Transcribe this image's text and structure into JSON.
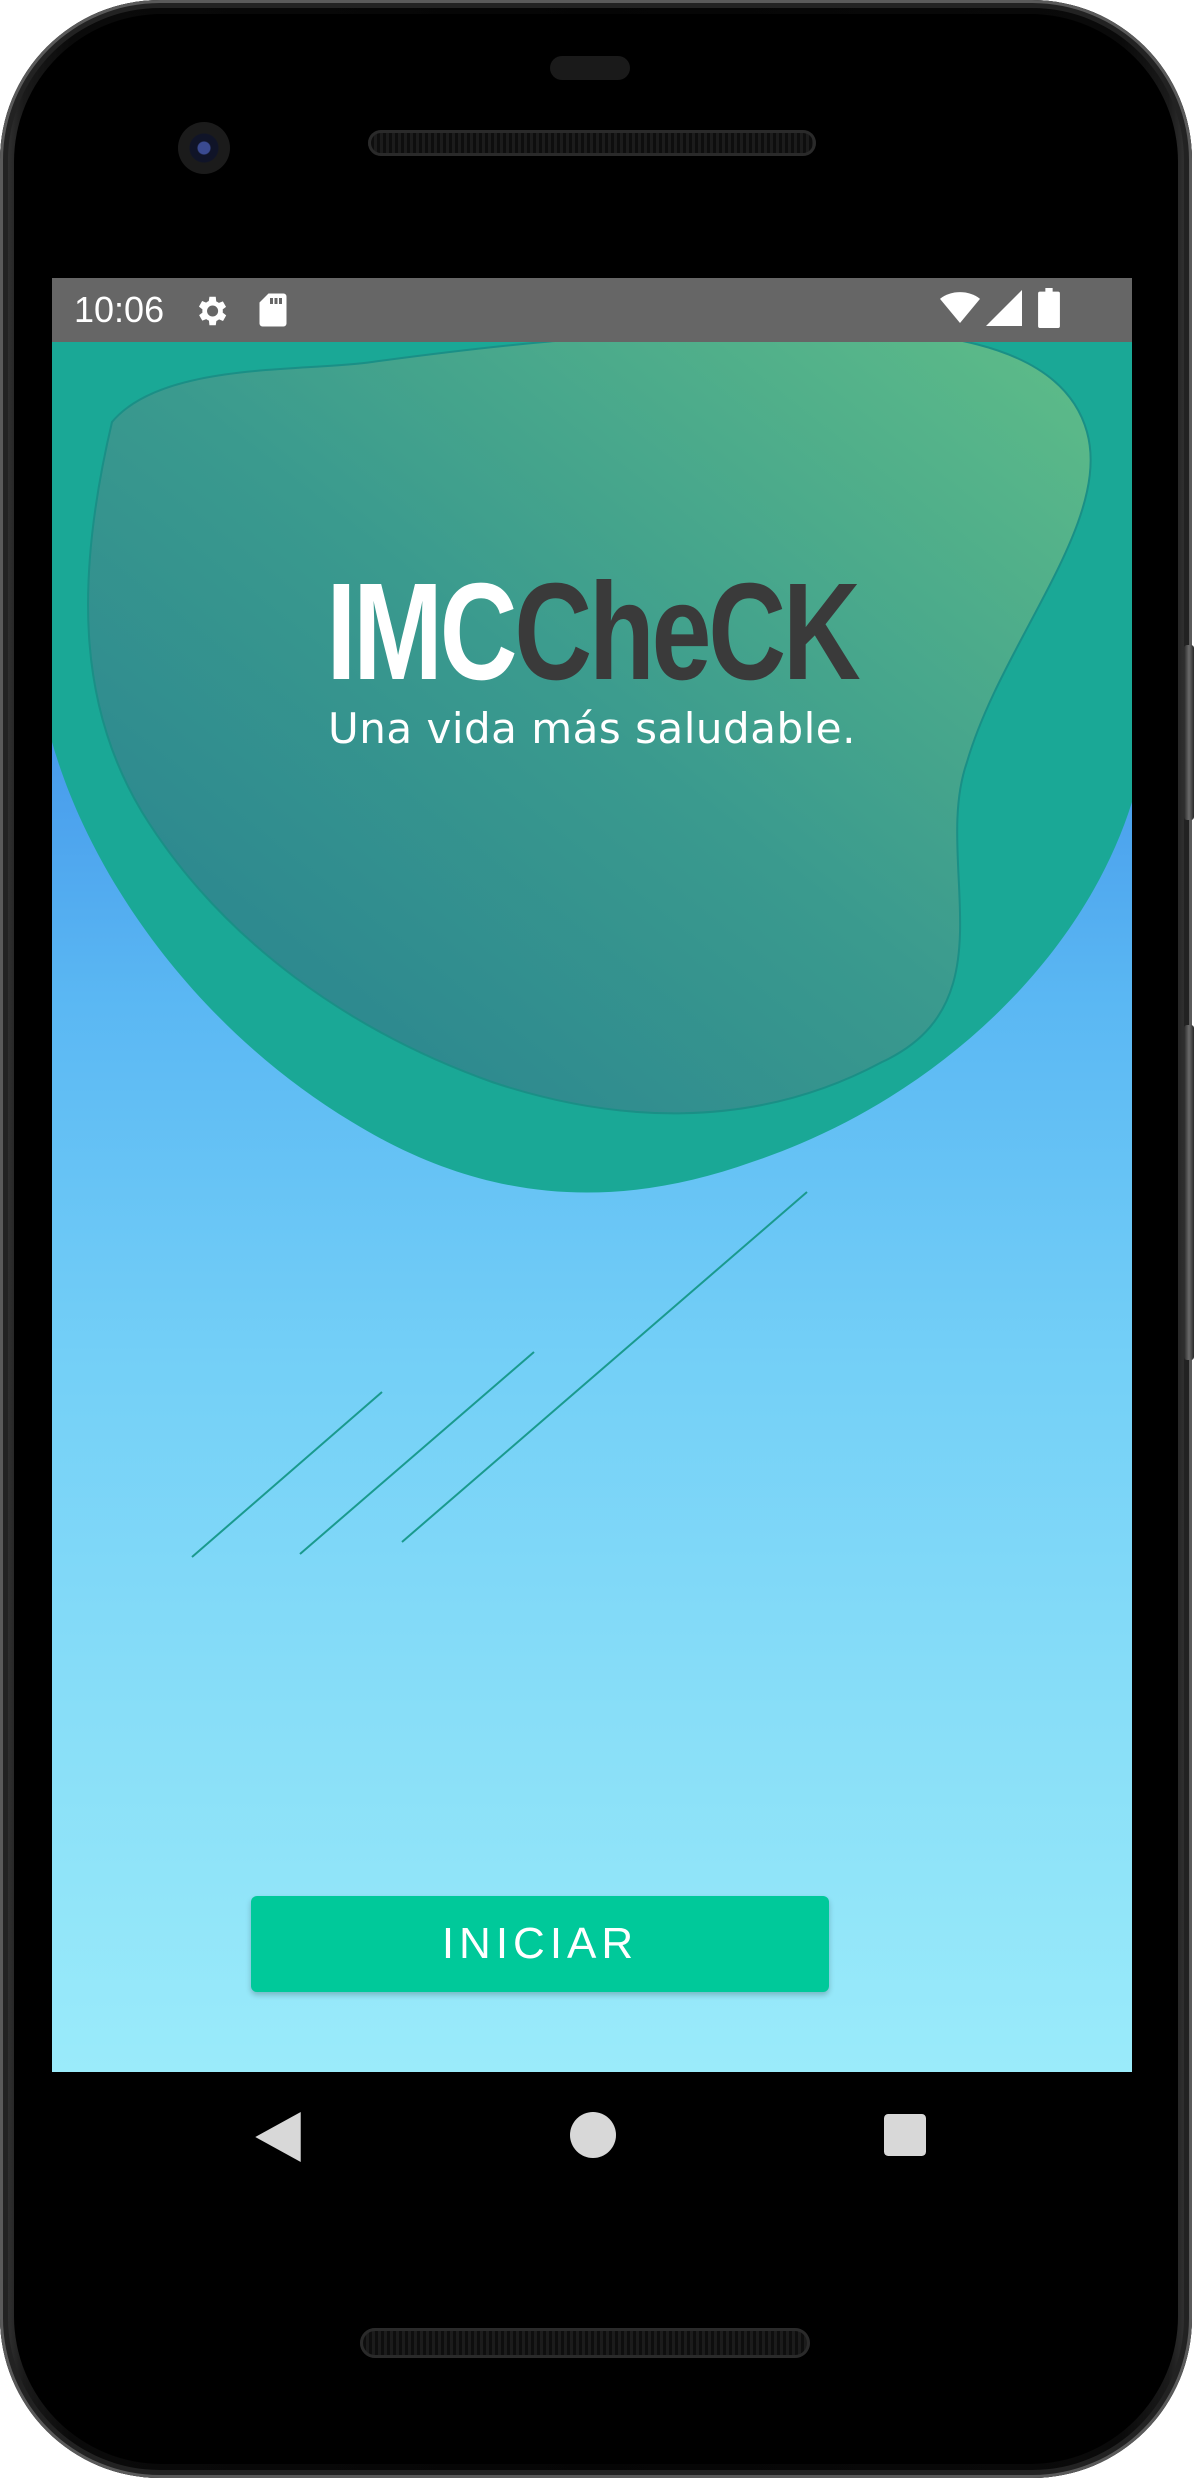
{
  "status_bar": {
    "time": "10:06",
    "left_icons": [
      "gear-icon",
      "sd-card-icon"
    ],
    "right_icons": [
      "wifi-icon",
      "cell-signal-icon",
      "battery-icon"
    ]
  },
  "app": {
    "logo_part1": "IMC",
    "logo_part2": "CheCK",
    "tagline": "Una vida más saludable.",
    "start_button_label": "INICIAR"
  },
  "navigation_bar": {
    "buttons": [
      "back-icon",
      "home-icon",
      "recents-icon"
    ]
  },
  "colors": {
    "status_bar": "#666666",
    "blob_teal": "#1aa896",
    "blob_inner_start": "#2a8a8e",
    "blob_inner_end": "#5dba8a",
    "background_top": "#2e6fdd",
    "background_bottom": "#9aebfa",
    "button": "#00c99a",
    "logo_dark": "#3a3a3a"
  }
}
